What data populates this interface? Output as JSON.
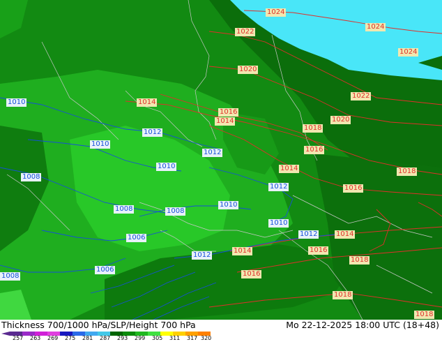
{
  "footer": {
    "title": "Thickness 700/1000 hPa/SLP/Height 700 hPa",
    "datetime": "Mo 22-12-2025 18:00 UTC (18+48)"
  },
  "scale": {
    "ticks": [
      "257",
      "263",
      "269",
      "275",
      "281",
      "287",
      "293",
      "299",
      "305",
      "311",
      "317",
      "320"
    ],
    "colors": [
      "#5a2a90",
      "#9a2ac8",
      "#d020d8",
      "#e040e0",
      "#1818c0",
      "#2a6ae8",
      "#40a8f0",
      "#44c8e8",
      "#006400",
      "#0a8a0a",
      "#20b820",
      "#40e040",
      "#ffff00",
      "#ffd000",
      "#ffa000",
      "#ff8000"
    ]
  },
  "colors": {
    "sea": "#49e6f8",
    "dark_green": "#0b6e0b",
    "mid_green": "#128a12",
    "light_green": "#1fae1f",
    "bright_green": "#28c828",
    "isobar_red": "#e0302a",
    "isobar_blue": "#1550d8"
  },
  "labels": [
    {
      "text": "1024",
      "color": "red"
    },
    {
      "text": "1024",
      "color": "red"
    },
    {
      "text": "1024",
      "color": "red"
    },
    {
      "text": "1022",
      "color": "red"
    },
    {
      "text": "1022",
      "color": "red"
    },
    {
      "text": "1020",
      "color": "red"
    },
    {
      "text": "1020",
      "color": "red"
    },
    {
      "text": "1014",
      "color": "red"
    },
    {
      "text": "1016",
      "color": "red"
    },
    {
      "text": "1014",
      "color": "red"
    },
    {
      "text": "1018",
      "color": "red"
    },
    {
      "text": "1016",
      "color": "red"
    },
    {
      "text": "1014",
      "color": "red"
    },
    {
      "text": "1018",
      "color": "red"
    },
    {
      "text": "1016",
      "color": "red"
    },
    {
      "text": "1014",
      "color": "red"
    },
    {
      "text": "1014",
      "color": "red"
    },
    {
      "text": "1016",
      "color": "red"
    },
    {
      "text": "1018",
      "color": "red"
    },
    {
      "text": "1016",
      "color": "red"
    },
    {
      "text": "1018",
      "color": "red"
    },
    {
      "text": "1018",
      "color": "red"
    },
    {
      "text": "1010",
      "color": "blue"
    },
    {
      "text": "1012",
      "color": "blue"
    },
    {
      "text": "1010",
      "color": "blue"
    },
    {
      "text": "1012",
      "color": "blue"
    },
    {
      "text": "1010",
      "color": "blue"
    },
    {
      "text": "1008",
      "color": "blue"
    },
    {
      "text": "1012",
      "color": "blue"
    },
    {
      "text": "1008",
      "color": "blue"
    },
    {
      "text": "1008",
      "color": "blue"
    },
    {
      "text": "1010",
      "color": "blue"
    },
    {
      "text": "1010",
      "color": "blue"
    },
    {
      "text": "1006",
      "color": "blue"
    },
    {
      "text": "1012",
      "color": "blue"
    },
    {
      "text": "1012",
      "color": "blue"
    },
    {
      "text": "1006",
      "color": "blue"
    },
    {
      "text": "1008",
      "color": "blue"
    }
  ]
}
